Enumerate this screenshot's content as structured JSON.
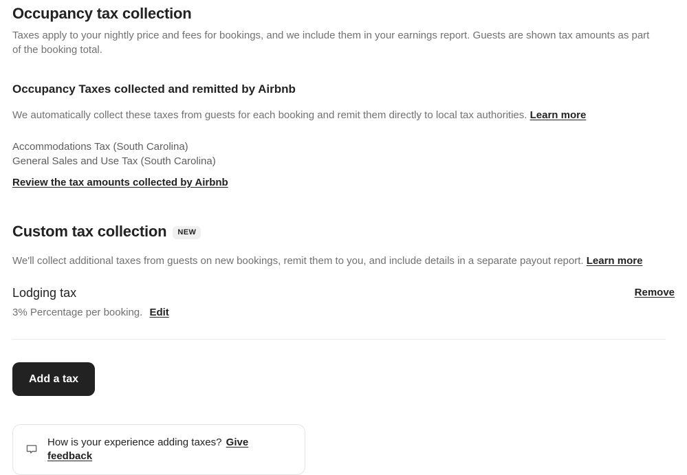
{
  "occupancy": {
    "title": "Occupancy tax collection",
    "description": "Taxes apply to your nightly price and fees for bookings, and we include them in your earnings report. Guests are shown tax amounts as part of the booking total."
  },
  "remitted": {
    "title": "Occupancy Taxes collected and remitted by Airbnb",
    "description": "We automatically collect these taxes from guests for each booking and remit them directly to local tax authorities.",
    "learn_more_label": "Learn more",
    "taxes": [
      "Accommodations Tax (South Carolina)",
      "General Sales and Use Tax (South Carolina)"
    ],
    "review_link_label": "Review the tax amounts collected by Airbnb"
  },
  "custom": {
    "title": "Custom tax collection",
    "badge_label": "New",
    "description": "We'll collect additional taxes from guests on new bookings, remit them to you, and include details in a separate payout report.",
    "learn_more_label": "Learn more",
    "taxes": [
      {
        "name": "Lodging tax",
        "meta": "3% Percentage per booking.",
        "edit_label": "Edit",
        "remove_label": "Remove"
      }
    ],
    "add_tax_label": "Add a tax"
  },
  "feedback": {
    "icon": "speech-bubble-icon",
    "prompt": "How is your experience adding taxes?",
    "link_label": "Give feedback"
  },
  "colors": {
    "text_primary": "#222222",
    "text_secondary": "#717171",
    "button_bg": "#222222",
    "badge_bg": "#f0f0f0",
    "divider": "#ebebeb",
    "border": "#e4e4e4"
  }
}
